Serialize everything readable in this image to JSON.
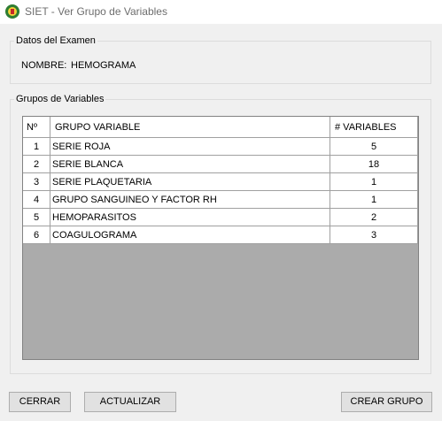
{
  "window": {
    "title": "SIET - Ver Grupo de Variables"
  },
  "exam": {
    "group_label": "Datos del Examen",
    "name_label": "NOMBRE:",
    "name_value": "HEMOGRAMA"
  },
  "groups": {
    "group_label": "Grupos de Variables",
    "columns": [
      "Nº",
      "GRUPO VARIABLE",
      "# VARIABLES"
    ],
    "rows": [
      {
        "n": "1",
        "grupo": "SERIE ROJA",
        "variables": "5"
      },
      {
        "n": "2",
        "grupo": "SERIE BLANCA",
        "variables": "18"
      },
      {
        "n": "3",
        "grupo": "SERIE PLAQUETARIA",
        "variables": "1"
      },
      {
        "n": "4",
        "grupo": "GRUPO SANGUINEO Y FACTOR RH",
        "variables": "1"
      },
      {
        "n": "5",
        "grupo": "HEMOPARASITOS",
        "variables": "2"
      },
      {
        "n": "6",
        "grupo": "COAGULOGRAMA",
        "variables": "3"
      }
    ]
  },
  "buttons": {
    "cerrar": "CERRAR",
    "actualizar": "ACTUALIZAR",
    "crear_grupo": "CREAR GRUPO"
  },
  "colors": {
    "window_bg": "#f0f0f0",
    "titlebar_bg": "#ffffff",
    "grid_bg": "#ababab"
  },
  "icons": {
    "app": "siet-logo-icon"
  }
}
